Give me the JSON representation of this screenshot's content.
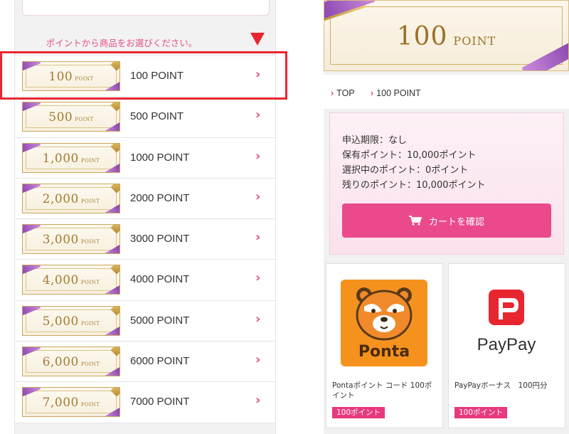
{
  "colors": {
    "accent_pink": "#e2508a",
    "highlight_red": "#e8262f",
    "gold": "#a47a30",
    "ribbon_purple": "#8a3fb0"
  },
  "left": {
    "instruction": "ポイントから商品をお選びください。",
    "items": [
      {
        "thumb_number": "100",
        "thumb_unit": "POINT",
        "label": "100 POINT",
        "selected": true
      },
      {
        "thumb_number": "500",
        "thumb_unit": "POINT",
        "label": "500 POINT"
      },
      {
        "thumb_number": "1,000",
        "thumb_unit": "POINT",
        "label": "1000 POINT"
      },
      {
        "thumb_number": "2,000",
        "thumb_unit": "POINT",
        "label": "2000 POINT"
      },
      {
        "thumb_number": "3,000",
        "thumb_unit": "POINT",
        "label": "3000 POINT"
      },
      {
        "thumb_number": "4,000",
        "thumb_unit": "POINT",
        "label": "4000 POINT"
      },
      {
        "thumb_number": "5,000",
        "thumb_unit": "POINT",
        "label": "5000 POINT"
      },
      {
        "thumb_number": "6,000",
        "thumb_unit": "POINT",
        "label": "6000 POINT"
      },
      {
        "thumb_number": "7,000",
        "thumb_unit": "POINT",
        "label": "7000 POINT"
      }
    ],
    "chevron": "›"
  },
  "right": {
    "banner_number": "100",
    "banner_unit": "POINT",
    "breadcrumb": {
      "home": "TOP",
      "current": "100 POINT",
      "marker": "›"
    },
    "info": {
      "deadline": "申込期限：なし",
      "owned": "保有ポイント：10,000ポイント",
      "selected": "選択中のポイント：0ポイント",
      "remaining": "残りのポイント：10,000ポイント"
    },
    "cart_button": "カートを確認",
    "products": [
      {
        "logo_text": "Ponta",
        "title": "Pontaポイント コード 100ポイント",
        "badge": "100ポイント"
      },
      {
        "logo_text": "PayPay",
        "title": "PayPayボーナス　100円分",
        "badge": "100ポイント"
      }
    ]
  }
}
